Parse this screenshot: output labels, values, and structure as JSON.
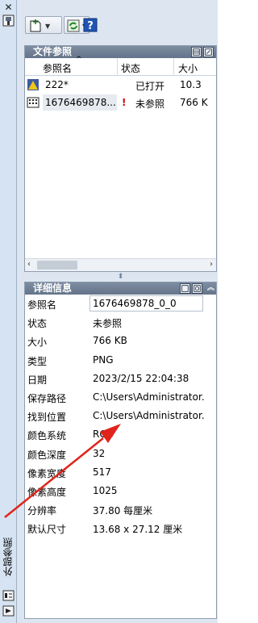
{
  "palette": {
    "title": "外部参照",
    "close_glyph": "✕"
  },
  "toolbar": {
    "attach_icon": "attach-dwg-icon",
    "refresh_icon": "refresh-icon",
    "help_label": "?"
  },
  "file_refs": {
    "title": "文件参照",
    "columns": {
      "name": "参照名",
      "status": "状态",
      "size": "大小"
    },
    "rows": [
      {
        "name": "222*",
        "alert": "",
        "status": "已打开",
        "size": "10.3",
        "icon": "dwg-file-icon"
      },
      {
        "name": "1676469878...",
        "alert": "!",
        "status": "未参照",
        "size": "766 K",
        "icon": "raster-image-icon"
      }
    ],
    "scroll_left": "‹",
    "scroll_right": "›"
  },
  "details": {
    "title": "详细信息",
    "rows": [
      {
        "key": "参照名",
        "value": "1676469878_0_0"
      },
      {
        "key": "状态",
        "value": "未参照"
      },
      {
        "key": "大小",
        "value": "766 KB"
      },
      {
        "key": "类型",
        "value": "PNG"
      },
      {
        "key": "日期",
        "value": "2023/2/15 22:04:38"
      },
      {
        "key": "保存路径",
        "value": "C:\\Users\\Administrator."
      },
      {
        "key": "找到位置",
        "value": "C:\\Users\\Administrator."
      },
      {
        "key": "颜色系统",
        "value": "RGB"
      },
      {
        "key": "颜色深度",
        "value": "32"
      },
      {
        "key": "像素宽度",
        "value": "517"
      },
      {
        "key": "像素高度",
        "value": "1025"
      },
      {
        "key": "分辨率",
        "value": "37.80 每厘米"
      },
      {
        "key": "默认尺寸",
        "value": "13.68 x 27.12 厘米"
      }
    ]
  },
  "colors": {
    "panel_bg": "#dde6f0",
    "header_bg": "#6f7e93",
    "annotation_arrow": "#e0241b",
    "alert": "#d40000"
  }
}
